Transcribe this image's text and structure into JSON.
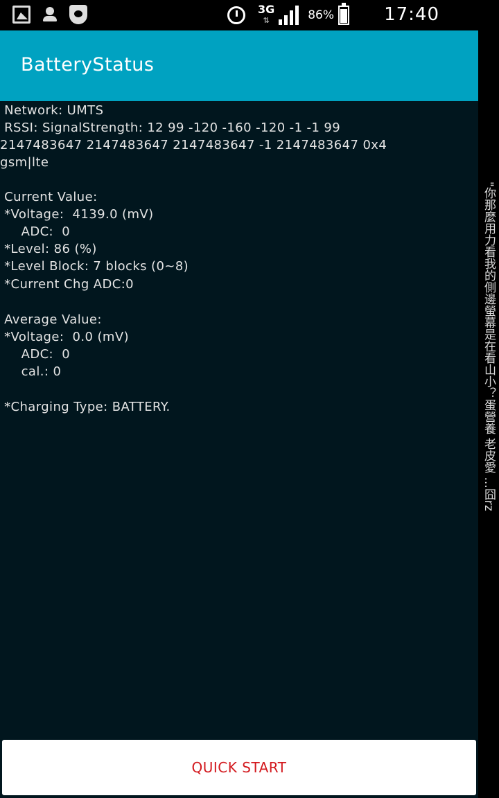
{
  "status_bar": {
    "icons_left": [
      "gallery-icon",
      "person-icon",
      "shield-icon"
    ],
    "icons_right": [
      "alarm-icon",
      "signal-icon",
      "battery-icon"
    ],
    "network_type": "3G",
    "data_arrows": "⇅",
    "battery_percent": "86%",
    "time": "17:40"
  },
  "app_bar": {
    "title": "BatteryStatus"
  },
  "content": {
    "network": " Network: UMTS",
    "rssi_1": " RSSI: SignalStrength: 12 99 -120 -160 -120 -1 -1 99",
    "rssi_2": "2147483647 2147483647 2147483647 -1 2147483647 0x4",
    "rssi_3": "gsm|lte",
    "current_header": " Current Value:",
    "current_voltage": " *Voltage:  4139.0 (mV)",
    "current_adc": "     ADC:  0",
    "current_level": " *Level: 86 (%)",
    "current_level_block": " *Level Block: 7 blocks (0~8)",
    "current_chg_adc": " *Current Chg ADC:0",
    "average_header": " Average Value:",
    "average_voltage": " *Voltage:  0.0 (mV)",
    "average_adc": "     ADC:  0",
    "average_cal": "     cal.: 0",
    "charging_type": " *Charging Type: BATTERY."
  },
  "side_text": "\"你那麼用力看我的側邊螢幕是在看山小？蛋營養 老皮愛 ...囧rz",
  "quick_start_label": "QUICK START",
  "colors": {
    "app_bar": "#00a2c1",
    "content_bg": "#01161e",
    "button_text": "#d3191e"
  }
}
